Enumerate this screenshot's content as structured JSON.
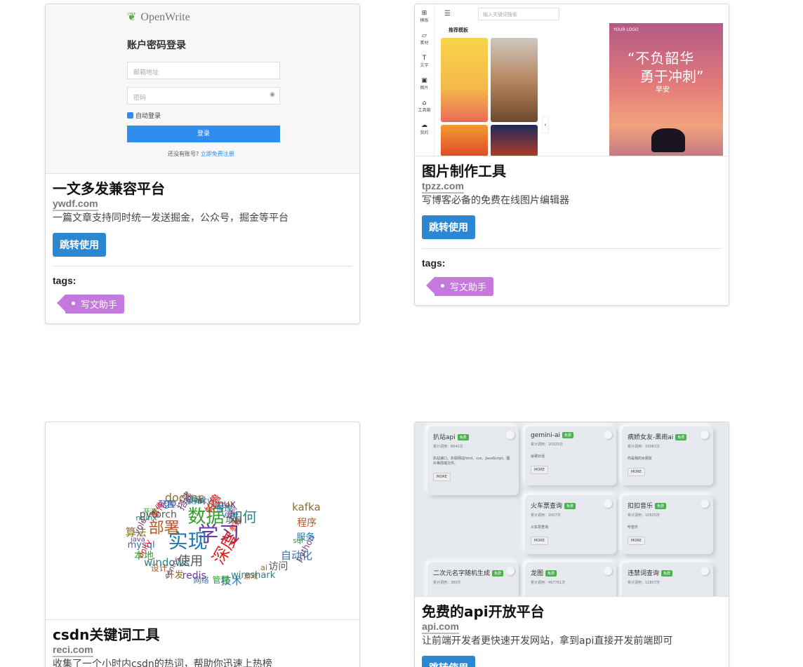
{
  "cards": [
    {
      "title": "一文多发兼容平台",
      "domain": "ywdf.com",
      "desc": "一篇文章支持同时统一发送掘金，公众号，掘金等平台",
      "button": "跳转使用",
      "tags_label": "tags:",
      "tag": "写文助手",
      "thumb": {
        "logo": "OpenWrite",
        "heading": "账户密码登录",
        "email_placeholder": "邮箱地址",
        "password_placeholder": "密码",
        "remember": "自动登录",
        "login": "登录",
        "register_prompt": "还没有账号?",
        "register_link": "立即免费注册"
      }
    },
    {
      "title": "图片制作工具",
      "domain": "tpzz.com",
      "desc": "写博客必备的免费在线图片编辑器",
      "button": "跳转使用",
      "tags_label": "tags:",
      "tag": "写文助手",
      "thumb": {
        "search_placeholder": "输入关键词搜索",
        "section": "推荐模板",
        "side": [
          "模板",
          "素材",
          "文字",
          "图片",
          "工具箱",
          "我的"
        ],
        "poster_logo": "YOUR LOGO",
        "poster_line1": "“不负韶华",
        "poster_line2": "勇于冲刺”",
        "poster_line3": "早安"
      }
    },
    {
      "title": "csdn关键词工具",
      "domain": "reci.com",
      "desc": "收集了一个小时内csdn的热词，帮助你迅速上热榜"
    },
    {
      "title": "免费的api开放平台",
      "domain": "api.com",
      "desc": "让前端开发者更快速开发网站，拿到api直接开发前端即可",
      "button": "跳转使用",
      "thumb": {
        "apis": [
          {
            "name": "扒站api",
            "stat": "累计调用：6642次",
            "desc": "扒站接口，扒取网站html、css、JavaScript、图片等前端文件。",
            "more": "MORE"
          },
          {
            "name": "gemini-ai",
            "stat": "累计调用：10325次",
            "desc": "谷歌对话",
            "more": "MORE"
          },
          {
            "name": "病娇女友-黑雨ai",
            "stat": "累计调用：10082次",
            "desc": "你是我的女朋友",
            "more": "MORE"
          },
          {
            "name": "火车票查询",
            "stat": "累计调用：2007次",
            "desc": "火车票查询",
            "more": "MORE"
          },
          {
            "name": "扣扣音乐",
            "stat": "累计调用：10620次",
            "desc": "听音乐",
            "more": "MORE"
          },
          {
            "name": "二次元名字随机生成",
            "stat": "累计调用：380次",
            "desc": "",
            "more": ""
          },
          {
            "name": "龙图",
            "stat": "累计调用：467761次",
            "desc": "",
            "more": ""
          },
          {
            "name": "违禁词查询",
            "stat": "累计调用：11807次",
            "desc": "",
            "more": ""
          }
        ]
      }
    }
  ],
  "cloud_words": [
    "学习",
    "实现",
    "数据",
    "深度",
    "部署",
    "如何",
    "使用",
    "docker",
    "python",
    "mysql",
    "linux",
    "技术",
    "开源",
    "参数",
    "设计",
    "测试",
    "访问",
    "算法",
    "代码",
    "网络",
    "配置",
    "服务",
    "本地",
    "帕鲁",
    "游戏",
    "nginx",
    "项目",
    "开发",
    "搭建",
    "自动化",
    "java",
    "原理",
    "管理",
    "事件",
    "程序",
    "windows",
    "api",
    "ai",
    "yolo",
    "vue",
    "redis",
    "go",
    "sql",
    "unity",
    "flutter",
    "wireshark",
    "pytorch",
    "kafka",
    "centos",
    "opencv"
  ]
}
